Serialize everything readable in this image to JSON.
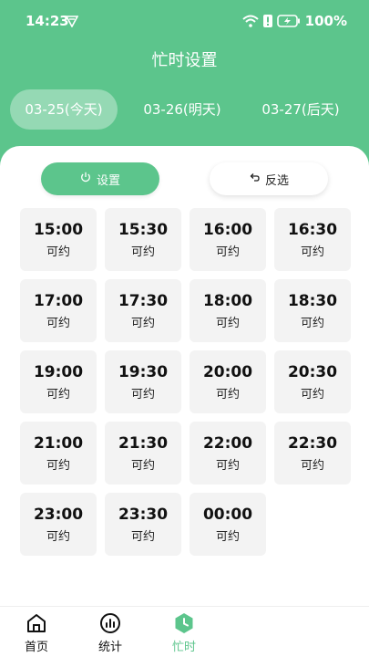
{
  "status": {
    "time": "14:23",
    "battery": "100%"
  },
  "page": {
    "title": "忙时设置"
  },
  "date_tabs": [
    {
      "label": "03-25(今天)",
      "active": true
    },
    {
      "label": "03-26(明天)",
      "active": false
    },
    {
      "label": "03-27(后天)",
      "active": false
    }
  ],
  "actions": {
    "set_label": "设置",
    "invert_label": "反选"
  },
  "slots": [
    {
      "time": "15:00",
      "status": "可约"
    },
    {
      "time": "15:30",
      "status": "可约"
    },
    {
      "time": "16:00",
      "status": "可约"
    },
    {
      "time": "16:30",
      "status": "可约"
    },
    {
      "time": "17:00",
      "status": "可约"
    },
    {
      "time": "17:30",
      "status": "可约"
    },
    {
      "time": "18:00",
      "status": "可约"
    },
    {
      "time": "18:30",
      "status": "可约"
    },
    {
      "time": "19:00",
      "status": "可约"
    },
    {
      "time": "19:30",
      "status": "可约"
    },
    {
      "time": "20:00",
      "status": "可约"
    },
    {
      "time": "20:30",
      "status": "可约"
    },
    {
      "time": "21:00",
      "status": "可约"
    },
    {
      "time": "21:30",
      "status": "可约"
    },
    {
      "time": "22:00",
      "status": "可约"
    },
    {
      "time": "22:30",
      "status": "可约"
    },
    {
      "time": "23:00",
      "status": "可约"
    },
    {
      "time": "23:30",
      "status": "可约"
    },
    {
      "time": "00:00",
      "status": "可约"
    }
  ],
  "nav": {
    "home": "首页",
    "stats": "统计",
    "busy": "忙时",
    "active": "busy"
  },
  "colors": {
    "accent": "#5cc58c",
    "slot_bg": "#f3f3f3"
  }
}
